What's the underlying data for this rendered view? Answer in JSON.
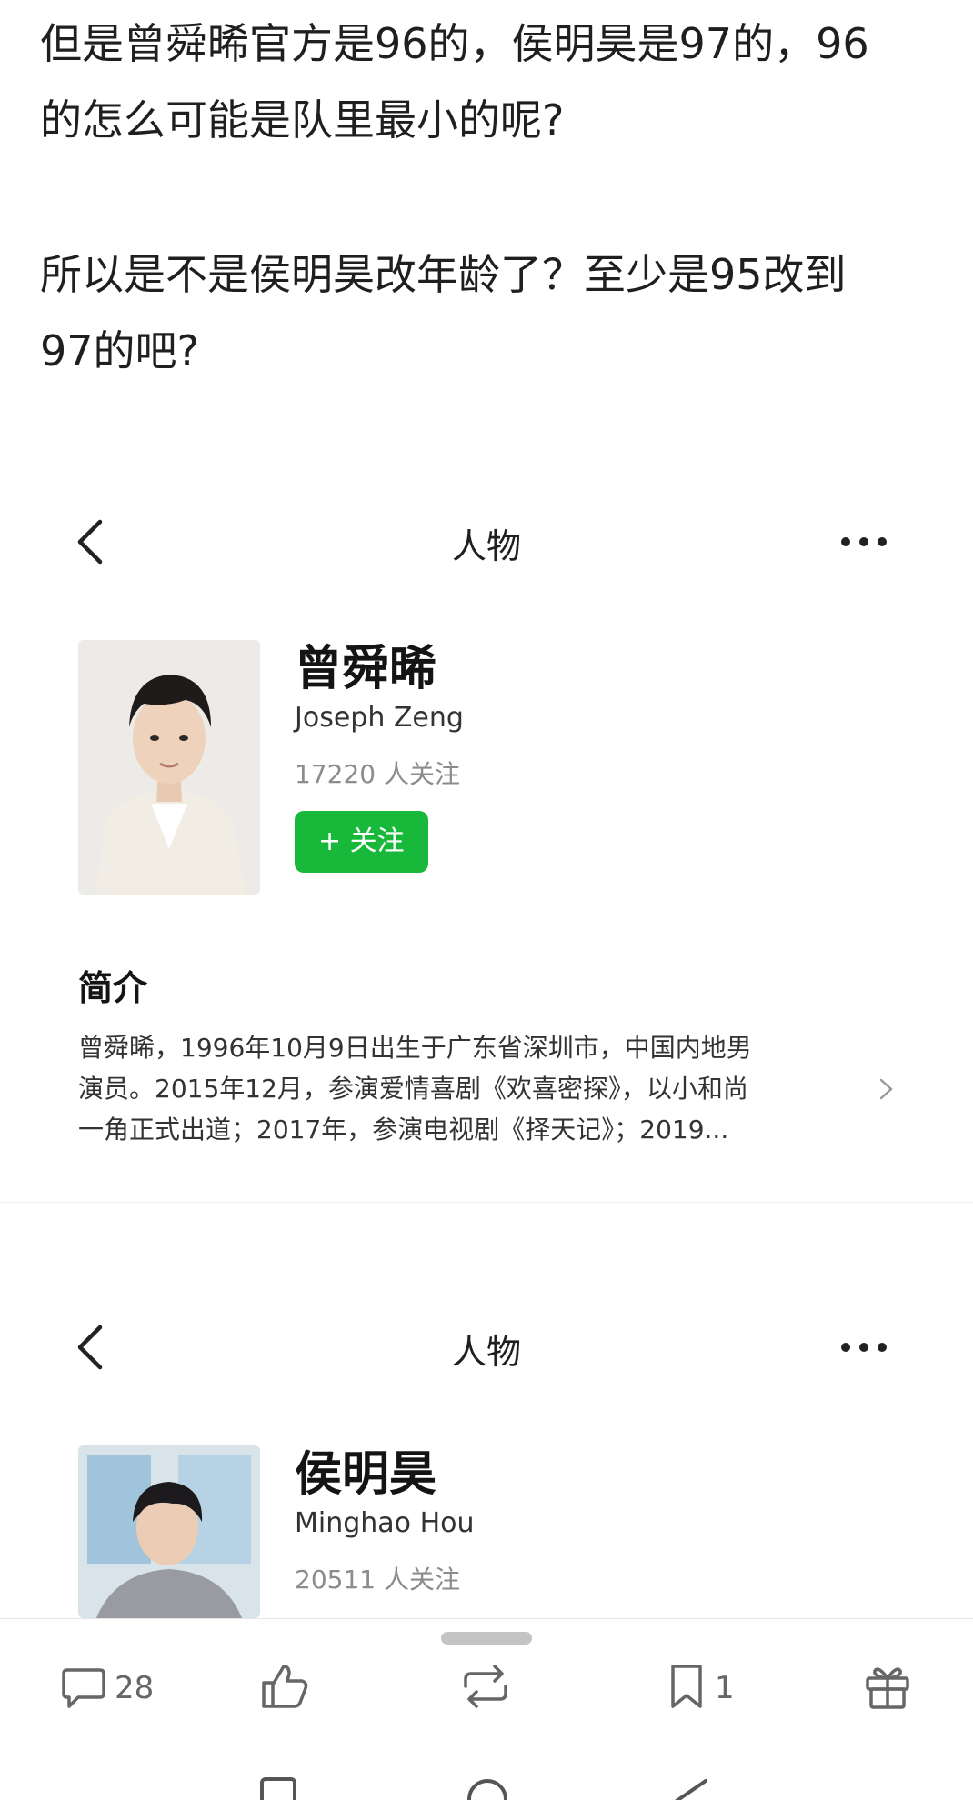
{
  "post": {
    "line1": "但是曾舜晞官方是96的，侯明昊是97的，96",
    "line2": "的怎么可能是队里最小的呢?",
    "line3": "所以是不是侯明昊改年龄了？至少是95改到",
    "line4": "97的吧?"
  },
  "cards": [
    {
      "header_title": "人物",
      "name": "曾舜晞",
      "english_name": "Joseph Zeng",
      "followers": "17220 人关注",
      "follow_label": "+ 关注",
      "intro_title": "简介",
      "intro_line1": "曾舜晞，1996年10月9日出生于广东省深圳市，中国内地男",
      "intro_line2": "演员。2015年12月，参演爱情喜剧《欢喜密探》，以小和尚",
      "intro_line3": "一角正式出道；2017年，参演电视剧《择天记》；2019..."
    },
    {
      "header_title": "人物",
      "name": "侯明昊",
      "english_name": "Minghao Hou",
      "followers": "20511 人关注"
    }
  ],
  "actions": {
    "comments": "28",
    "favorites": "1"
  },
  "colors": {
    "follow_button": "#18b93a",
    "text_primary": "#1f1f1f",
    "text_muted": "#8c8c8c"
  },
  "icons": [
    "back-arrow-icon",
    "more-dots-icon",
    "chevron-right-icon",
    "comment-icon",
    "like-icon",
    "repost-icon",
    "bookmark-icon",
    "gift-icon"
  ]
}
